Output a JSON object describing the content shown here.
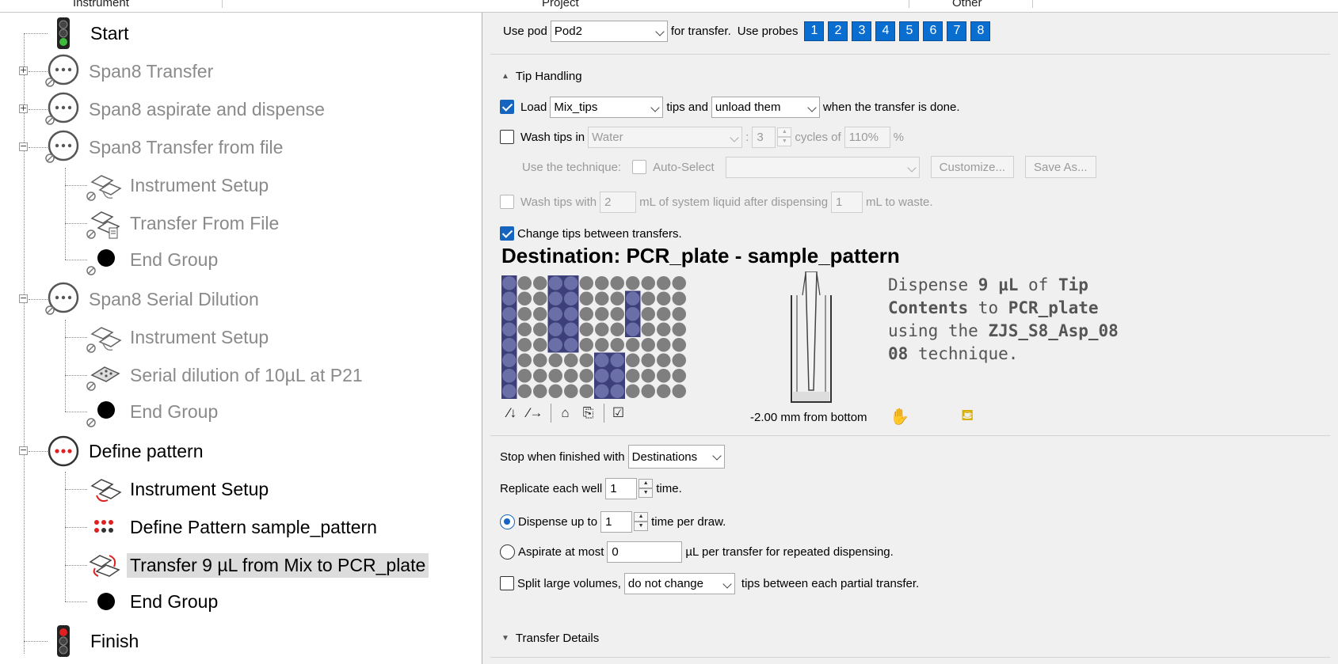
{
  "header": {
    "col1": "Instrument",
    "col2": "Project",
    "col3": "Other"
  },
  "tree": {
    "items": [
      {
        "label": "Start",
        "state": "active",
        "icon": "start-traffic-light-icon"
      },
      {
        "label": "Span8 Transfer",
        "state": "inactive",
        "icon": "group-icon"
      },
      {
        "label": "Span8 aspirate and dispense",
        "state": "inactive",
        "icon": "group-icon"
      },
      {
        "label": "Span8 Transfer from file",
        "state": "inactive",
        "icon": "group-icon"
      },
      {
        "label": "Instrument Setup",
        "state": "inactive",
        "icon": "instrument-setup-icon"
      },
      {
        "label": "Transfer From File",
        "state": "inactive",
        "icon": "transfer-from-file-icon"
      },
      {
        "label": "End Group",
        "state": "inactive",
        "icon": "end-group-icon"
      },
      {
        "label": "Span8 Serial Dilution",
        "state": "inactive",
        "icon": "group-icon"
      },
      {
        "label": "Instrument Setup",
        "state": "inactive",
        "icon": "instrument-setup-icon"
      },
      {
        "label": "Serial dilution of 10µL at P21",
        "state": "inactive",
        "icon": "serial-dilution-icon"
      },
      {
        "label": "End Group",
        "state": "inactive",
        "icon": "end-group-icon"
      },
      {
        "label": "Define pattern",
        "state": "active",
        "icon": "group-active-icon"
      },
      {
        "label": "Instrument Setup",
        "state": "active",
        "icon": "instrument-setup-icon"
      },
      {
        "label": "Define Pattern sample_pattern",
        "state": "active",
        "icon": "define-pattern-icon"
      },
      {
        "label": "Transfer 9 µL from Mix to PCR_plate",
        "state": "selected",
        "icon": "transfer-icon"
      },
      {
        "label": "End Group",
        "state": "active",
        "icon": "end-group-icon"
      },
      {
        "label": "Finish",
        "state": "active",
        "icon": "finish-traffic-light-icon"
      }
    ]
  },
  "panel": {
    "pod_prefix": "Use pod",
    "pod_value": "Pod2",
    "pod_suffix": "for transfer.",
    "probes_label": "Use probes",
    "probes": [
      "1",
      "2",
      "3",
      "4",
      "5",
      "6",
      "7",
      "8"
    ],
    "tip_handling": {
      "title": "Tip Handling",
      "load_label": "Load",
      "load_checked": true,
      "tips_value": "Mix_tips",
      "tips_and": "tips and",
      "unload_value": "unload them",
      "when_done": "when the transfer is done.",
      "wash_in_label": "Wash tips in",
      "wash_liquid": "Water",
      "colon": ":",
      "cycles_value": "3",
      "cycles_of": "cycles of",
      "percent_value": "110%",
      "percent_sign": "%",
      "technique_label": "Use the technique:",
      "auto_select_label": "Auto-Select",
      "technique_value": "",
      "customize_label": "Customize...",
      "save_as_label": "Save As...",
      "wash_with_label": "Wash tips with",
      "system_ml": "2",
      "system_text": "mL of system liquid after dispensing",
      "waste_ml": "1",
      "waste_text": "mL to waste.",
      "change_tips_label": "Change tips between transfers.",
      "change_tips_checked": true
    },
    "destination": {
      "title": "Destination: PCR_plate - sample_pattern",
      "mm_label": "-2.00 mm from bottom",
      "desc_1": "Dispense ",
      "desc_volume": "9 µL",
      "desc_2": " of ",
      "desc_source": "Tip Contents",
      "desc_3": " to ",
      "desc_dest": "PCR_plate",
      "desc_4": " using the ",
      "desc_technique": "ZJS_S8_Asp_0808",
      "desc_5": " technique.",
      "plate_rows": 8,
      "plate_cols": 12,
      "highlight_wells": [
        [
          0,
          0
        ],
        [
          1,
          0
        ],
        [
          2,
          0
        ],
        [
          3,
          0
        ],
        [
          4,
          0
        ],
        [
          5,
          0
        ],
        [
          6,
          0
        ],
        [
          7,
          0
        ],
        [
          0,
          3
        ],
        [
          1,
          3
        ],
        [
          2,
          3
        ],
        [
          3,
          3
        ],
        [
          4,
          3
        ],
        [
          0,
          4
        ],
        [
          1,
          4
        ],
        [
          2,
          4
        ],
        [
          3,
          4
        ],
        [
          4,
          4
        ],
        [
          1,
          8
        ],
        [
          2,
          8
        ],
        [
          3,
          8
        ],
        [
          5,
          6
        ],
        [
          6,
          6
        ],
        [
          7,
          6
        ],
        [
          5,
          7
        ],
        [
          6,
          7
        ],
        [
          7,
          7
        ]
      ]
    },
    "stop_label": "Stop when finished with",
    "stop_value": "Destinations",
    "replicate_label": "Replicate each well",
    "replicate_value": "1",
    "replicate_suffix": "time.",
    "dispense_label": "Dispense up to",
    "dispense_value": "1",
    "dispense_suffix": "time per draw.",
    "aspirate_label": "Aspirate at most",
    "aspirate_value": "0",
    "aspirate_suffix": "µL per transfer for repeated dispensing.",
    "split_label": "Split large volumes,",
    "split_value": "do not change",
    "split_suffix": "tips between each partial transfer.",
    "transfer_details": "Transfer Details"
  },
  "colors": {
    "probe": "#0a6ed1",
    "well_highlight": "#3d3f7a",
    "well_default": "#7f7f7f",
    "check": "#1565c0"
  }
}
